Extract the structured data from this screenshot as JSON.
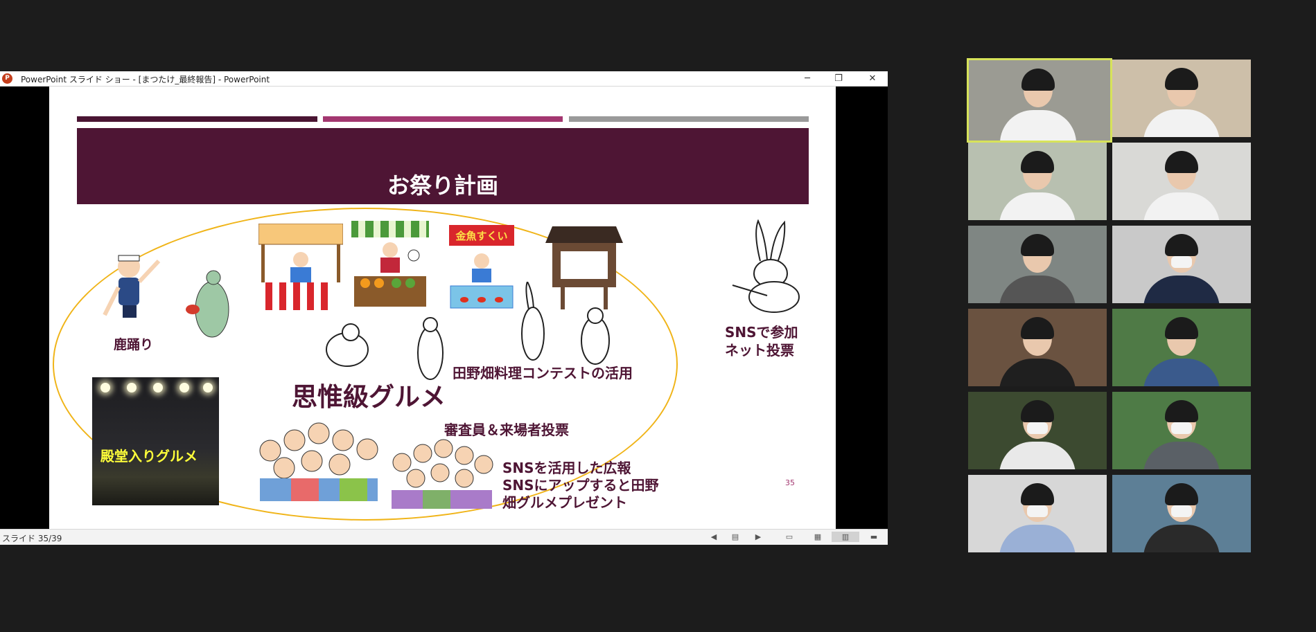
{
  "window": {
    "title": "PowerPoint スライド ショー - [まつたけ_最終報告] - PowerPoint",
    "logo_letter": "P",
    "minimize_glyph": "─",
    "maximize_glyph": "❐",
    "close_glyph": "✕"
  },
  "slide": {
    "title": "お祭り計画",
    "labels": {
      "shikaodori": "鹿踊り",
      "sns_vote_1": "SNSで参加",
      "sns_vote_2": "ネット投票",
      "contest": "田野畑料理コンテストの活用",
      "gourmet": "思惟級グルメ",
      "judges": "審査員＆来場者投票",
      "sns_pr_1": "SNSを活用した広報",
      "sns_pr_2": "SNSにアップすると田野",
      "sns_pr_3": "畑グルメプレゼント",
      "hall_of_fame": "殿堂入りグルメ",
      "goldfish_sign": "金魚すくい"
    },
    "page_number": "35"
  },
  "statusbar": {
    "slide_counter": "スライド 35/39",
    "icons": [
      "prev-icon",
      "menu-icon",
      "next-icon",
      "normal-view-icon",
      "slide-sorter-icon",
      "reading-view-icon",
      "slideshow-icon"
    ]
  },
  "colors": {
    "banner": "#4e1534",
    "text": "#4e1534",
    "accent_bar_2": "#a33770",
    "ellipse": "#f0b418",
    "active_speaker": "#d7e35a"
  },
  "participants": [
    {
      "id": 1,
      "active_speaker": true
    },
    {
      "id": 2
    },
    {
      "id": 3
    },
    {
      "id": 4
    },
    {
      "id": 5
    },
    {
      "id": 6
    },
    {
      "id": 7
    },
    {
      "id": 8
    },
    {
      "id": 9
    },
    {
      "id": 10
    },
    {
      "id": 11
    },
    {
      "id": 12
    }
  ]
}
